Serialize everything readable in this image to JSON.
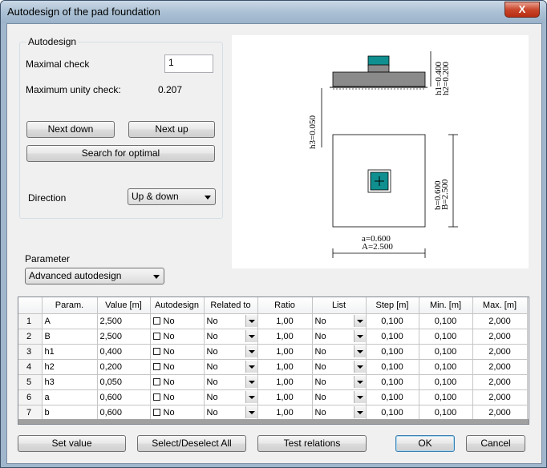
{
  "window": {
    "title": "Autodesign of the pad foundation",
    "close_glyph": "X"
  },
  "autodesign": {
    "legend": "Autodesign",
    "maximal_check_label": "Maximal check",
    "maximal_check_value": "1",
    "max_unity_label": "Maximum unity check:",
    "max_unity_value": "0.207",
    "next_down": "Next down",
    "next_up": "Next up",
    "search_optimal": "Search for optimal",
    "direction_label": "Direction",
    "direction_value": "Up & down"
  },
  "parameter": {
    "label": "Parameter",
    "value": "Advanced autodesign"
  },
  "drawing": {
    "dim_h1": "h1=0.400",
    "dim_h2": "h2=0.200",
    "dim_h3": "h3=0.050",
    "dim_b": "b=0.600",
    "dim_B": "B=2.500",
    "dim_a": "a=0.600",
    "dim_A": "A=2.500"
  },
  "table": {
    "columns": [
      "",
      "Param.",
      "Value [m]",
      "Autodesign",
      "Related to",
      "Ratio",
      "List",
      "Step [m]",
      "Min. [m]",
      "Max. [m]"
    ],
    "rows": [
      [
        "1",
        "A",
        "2,500",
        "No",
        "No",
        "1,00",
        "No",
        "0,100",
        "0,100",
        "2,000"
      ],
      [
        "2",
        "B",
        "2,500",
        "No",
        "No",
        "1,00",
        "No",
        "0,100",
        "0,100",
        "2,000"
      ],
      [
        "3",
        "h1",
        "0,400",
        "No",
        "No",
        "1,00",
        "No",
        "0,100",
        "0,100",
        "2,000"
      ],
      [
        "4",
        "h2",
        "0,200",
        "No",
        "No",
        "1,00",
        "No",
        "0,100",
        "0,100",
        "2,000"
      ],
      [
        "5",
        "h3",
        "0,050",
        "No",
        "No",
        "1,00",
        "No",
        "0,100",
        "0,100",
        "2,000"
      ],
      [
        "6",
        "a",
        "0,600",
        "No",
        "No",
        "1,00",
        "No",
        "0,100",
        "0,100",
        "2,000"
      ],
      [
        "7",
        "b",
        "0,600",
        "No",
        "No",
        "1,00",
        "No",
        "0,100",
        "0,100",
        "2,000"
      ]
    ]
  },
  "footer": {
    "set_value": "Set value",
    "select_deselect": "Select/Deselect All",
    "test_relations": "Test relations",
    "ok": "OK",
    "cancel": "Cancel"
  },
  "colors": {
    "column_teal": "#0f8f8f",
    "pad_gray": "#8a8a8a"
  }
}
